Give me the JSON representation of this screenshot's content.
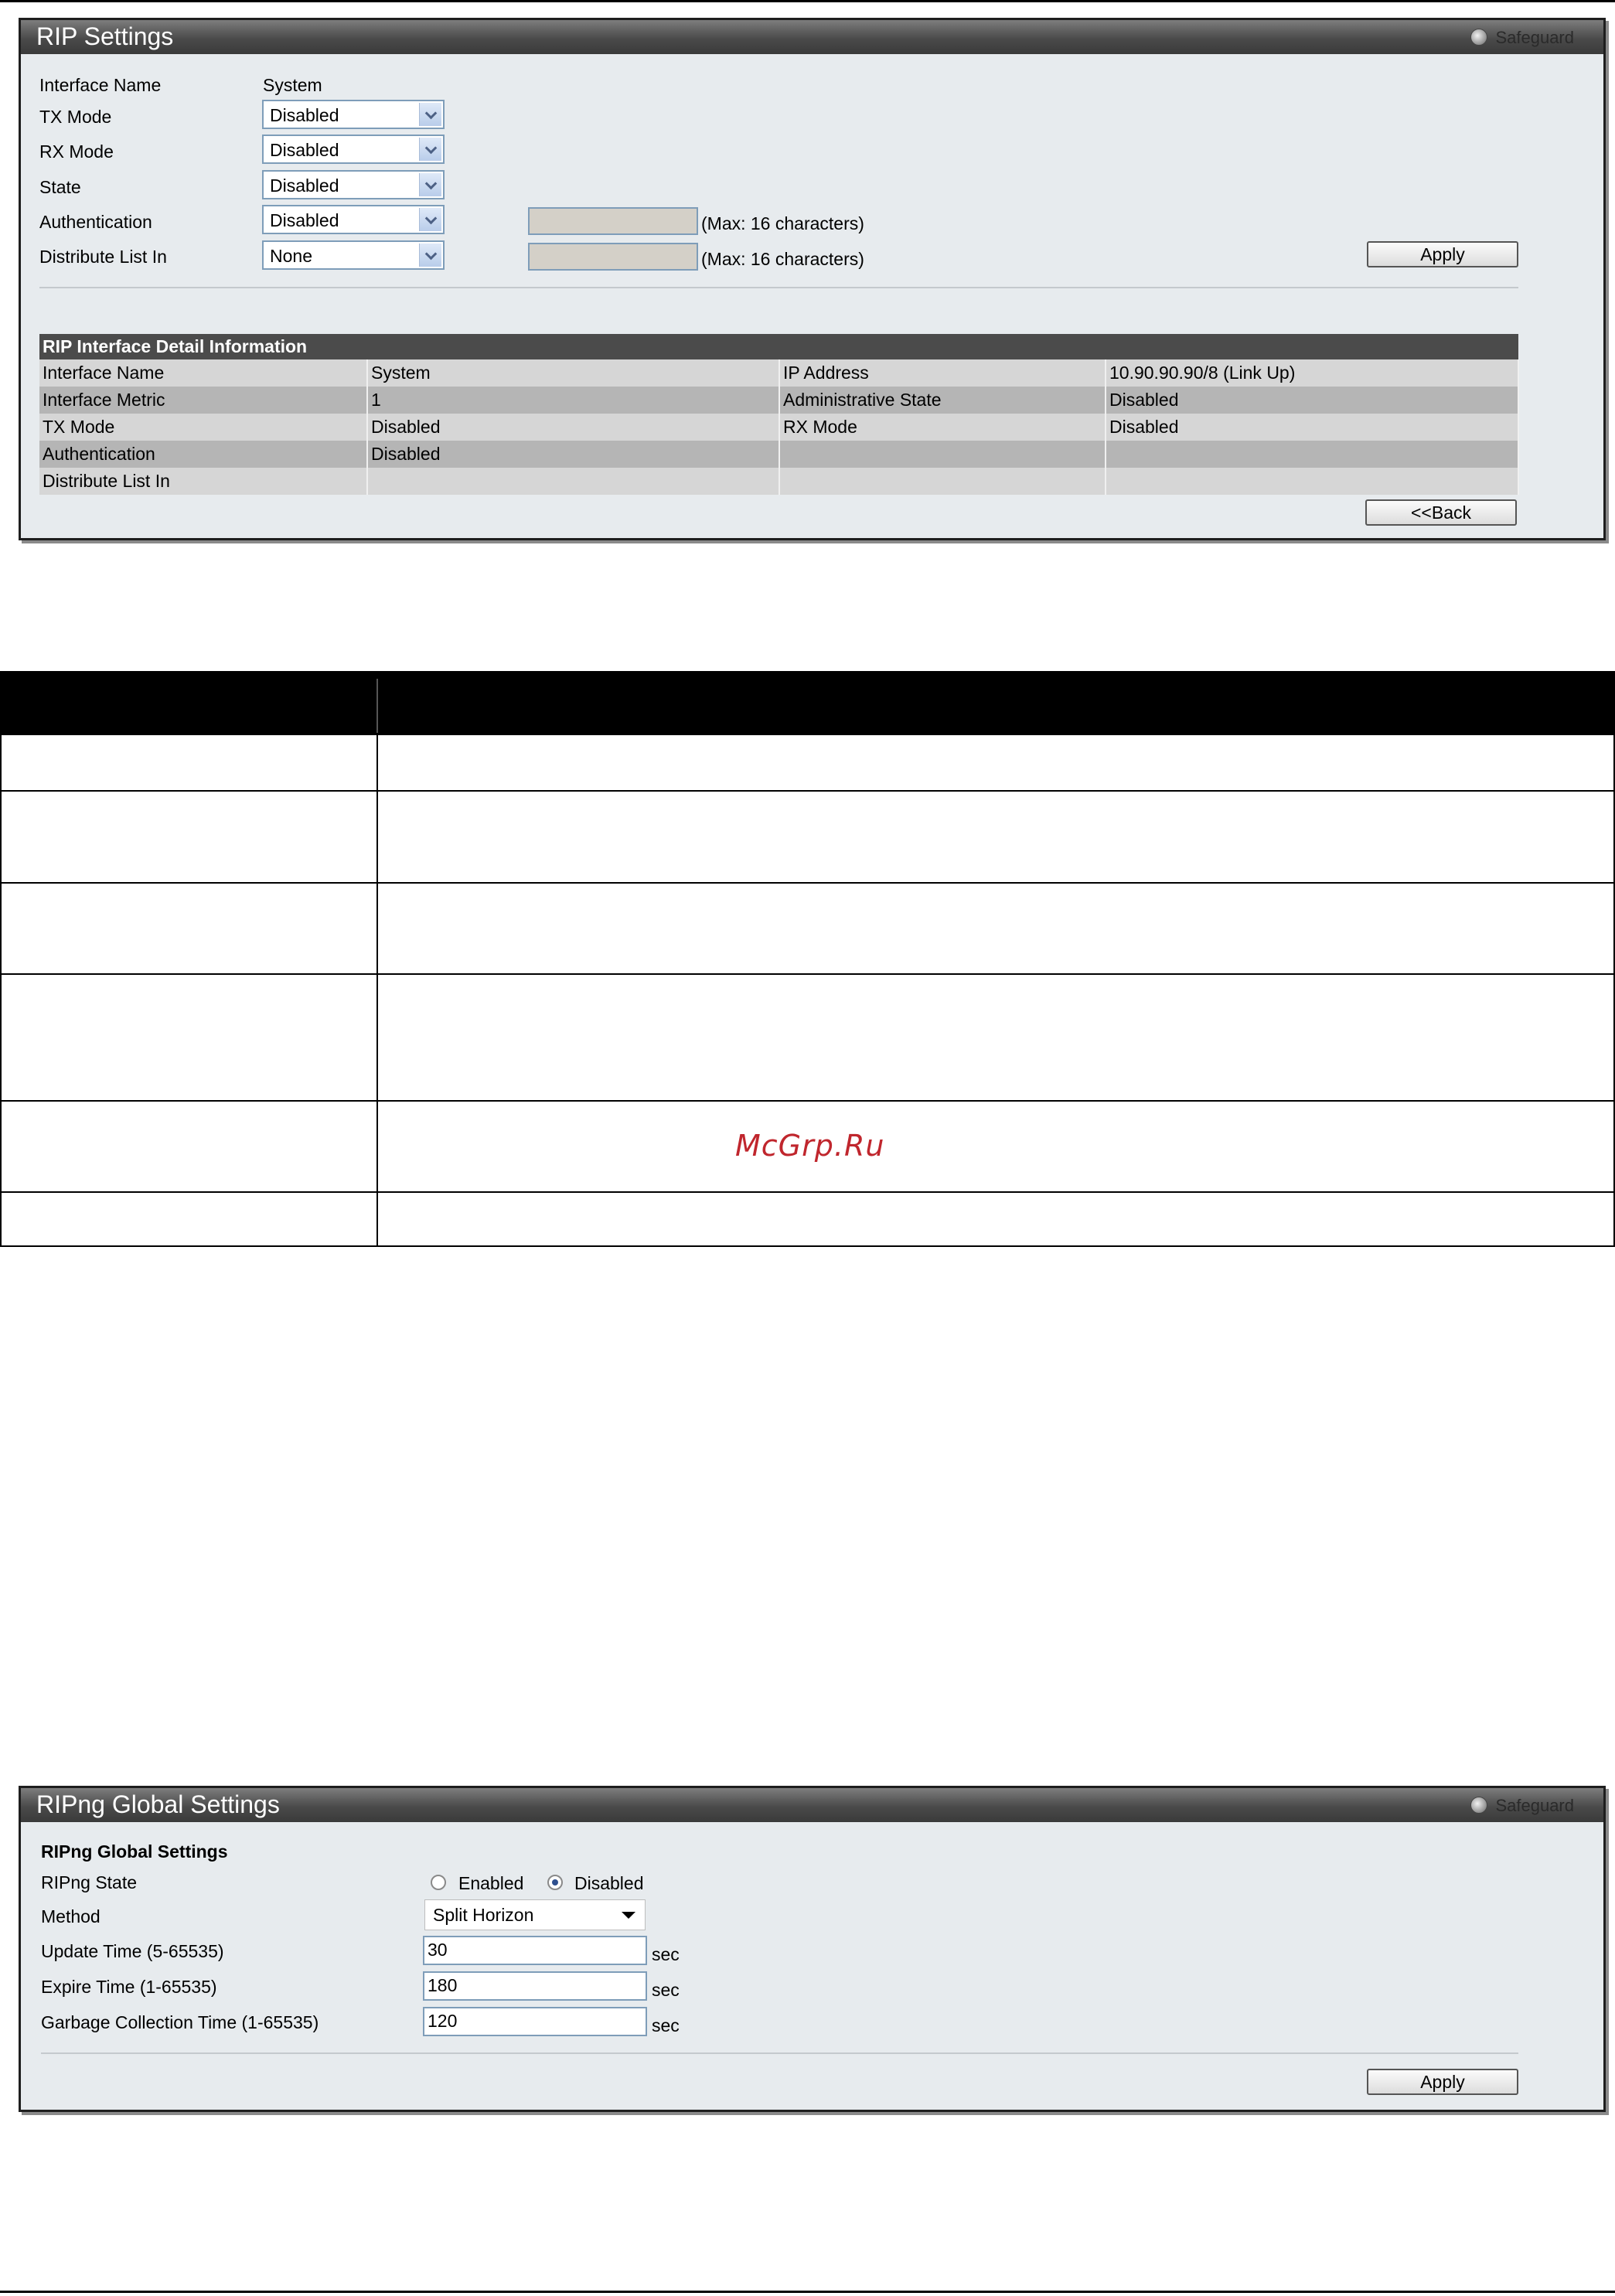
{
  "rip_panel": {
    "title": "RIP Settings",
    "safeguard": "Safeguard",
    "interface_name_label": "Interface Name",
    "interface_name_value": "System",
    "tx_mode_label": "TX Mode",
    "tx_mode_value": "Disabled",
    "rx_mode_label": "RX Mode",
    "rx_mode_value": "Disabled",
    "state_label": "State",
    "state_value": "Disabled",
    "authentication_label": "Authentication",
    "authentication_value": "Disabled",
    "auth_max_hint": "(Max: 16 characters)",
    "distribute_label": "Distribute List In",
    "distribute_value": "None",
    "distribute_max_hint": "(Max: 16 characters)",
    "apply_label": "Apply",
    "back_label": "<<Back"
  },
  "detail_table": {
    "header": "RIP Interface Detail Information",
    "rows": [
      [
        "Interface Name",
        "System",
        "IP Address",
        "10.90.90.90/8 (Link Up)"
      ],
      [
        "Interface Metric",
        "1",
        "Administrative State",
        "Disabled"
      ],
      [
        "TX Mode",
        "Disabled",
        "RX Mode",
        "Disabled"
      ],
      [
        "Authentication",
        "Disabled",
        "",
        ""
      ],
      [
        "Distribute List In",
        "",
        "",
        ""
      ]
    ]
  },
  "watermark": "McGrp.Ru",
  "ripng_panel": {
    "title": "RIPng Global Settings",
    "safeguard": "Safeguard",
    "section_label": "RIPng Global Settings",
    "state_label": "RIPng State",
    "enabled_label": "Enabled",
    "disabled_label": "Disabled",
    "state_selected": "Disabled",
    "method_label": "Method",
    "method_value": "Split Horizon",
    "update_label": "Update Time (5-65535)",
    "update_value": "30",
    "expire_label": "Expire Time (1-65535)",
    "expire_value": "180",
    "garbage_label": "Garbage Collection Time (1-65535)",
    "garbage_value": "120",
    "unit": "sec",
    "apply_label": "Apply"
  }
}
